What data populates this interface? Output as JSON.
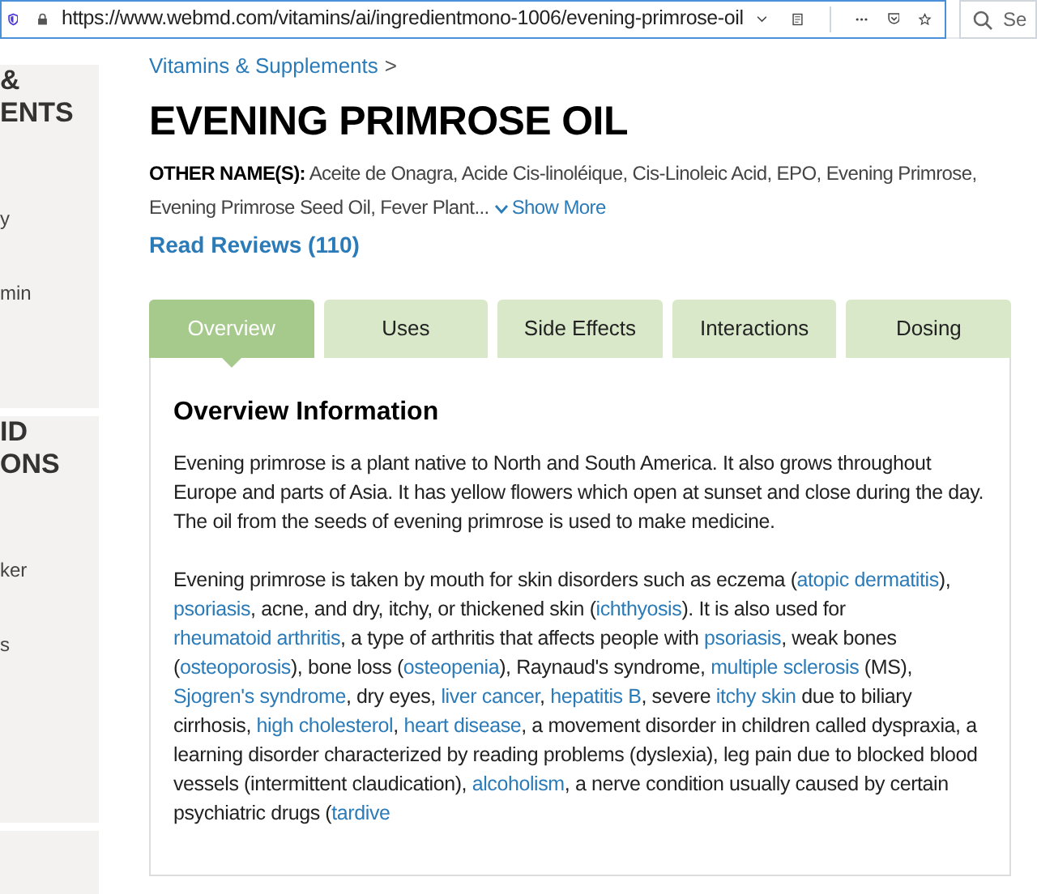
{
  "browser": {
    "url": "https://www.webmd.com/vitamins/ai/ingredientmono-1006/evening-primrose-oil",
    "search_placeholder": "Se"
  },
  "sidebar": {
    "panels": [
      {
        "lines": [
          "&",
          "ENTS"
        ],
        "items": [
          "y",
          "min"
        ]
      },
      {
        "lines": [
          "ID",
          "ONS"
        ],
        "items": [
          "ker",
          "s"
        ]
      }
    ]
  },
  "breadcrumb": {
    "label": "Vitamins & Supplements",
    "separator": ">"
  },
  "title": "EVENING PRIMROSE OIL",
  "other_names": {
    "label": "OTHER NAME(S):",
    "text": "Aceite de Onagra, Acide Cis-linoléique, Cis-Linoleic Acid, EPO, Evening Primrose, Evening Primrose Seed Oil, Fever Plant...",
    "toggle": "Show More"
  },
  "reviews_link": "Read Reviews (110)",
  "tabs": [
    {
      "label": "Overview",
      "selected": true
    },
    {
      "label": "Uses",
      "selected": false
    },
    {
      "label": "Side Effects",
      "selected": false
    },
    {
      "label": "Interactions",
      "selected": false
    },
    {
      "label": "Dosing",
      "selected": false
    }
  ],
  "section": {
    "heading": "Overview Information",
    "paragraphs": [
      [
        {
          "kind": "text",
          "text": "Evening primrose is a plant native to North and South America. It also grows throughout Europe and parts of Asia. It has yellow flowers which open at sunset and close during the day. The oil from the seeds of evening primrose is used to make medicine."
        }
      ],
      [
        {
          "kind": "text",
          "text": "Evening primrose is taken by mouth for skin disorders such as eczema ("
        },
        {
          "kind": "link",
          "text": "atopic dermatitis"
        },
        {
          "kind": "text",
          "text": "), "
        },
        {
          "kind": "link",
          "text": "psoriasis"
        },
        {
          "kind": "text",
          "text": ", acne, and dry, itchy, or thickened skin ("
        },
        {
          "kind": "link",
          "text": "ichthyosis"
        },
        {
          "kind": "text",
          "text": "). It is also used for "
        },
        {
          "kind": "link",
          "text": "rheumatoid arthritis"
        },
        {
          "kind": "text",
          "text": ", a type of arthritis that affects people with "
        },
        {
          "kind": "link",
          "text": "psoriasis"
        },
        {
          "kind": "text",
          "text": ", weak bones ("
        },
        {
          "kind": "link",
          "text": "osteoporosis"
        },
        {
          "kind": "text",
          "text": "), bone loss ("
        },
        {
          "kind": "link",
          "text": "osteopenia"
        },
        {
          "kind": "text",
          "text": "), Raynaud's syndrome, "
        },
        {
          "kind": "link",
          "text": "multiple sclerosis"
        },
        {
          "kind": "text",
          "text": " (MS), "
        },
        {
          "kind": "link",
          "text": "Sjogren's syndrome"
        },
        {
          "kind": "text",
          "text": ", dry eyes, "
        },
        {
          "kind": "link",
          "text": "liver cancer"
        },
        {
          "kind": "text",
          "text": ", "
        },
        {
          "kind": "link",
          "text": "hepatitis B"
        },
        {
          "kind": "text",
          "text": ", severe "
        },
        {
          "kind": "link",
          "text": "itchy skin"
        },
        {
          "kind": "text",
          "text": " due to biliary cirrhosis, "
        },
        {
          "kind": "link",
          "text": "high cholesterol"
        },
        {
          "kind": "text",
          "text": ", "
        },
        {
          "kind": "link",
          "text": "heart disease"
        },
        {
          "kind": "text",
          "text": ", a movement disorder in children called dyspraxia, a learning disorder characterized by reading problems (dyslexia), leg pain due to blocked blood vessels (intermittent claudication), "
        },
        {
          "kind": "link",
          "text": "alcoholism"
        },
        {
          "kind": "text",
          "text": ", a nerve condition usually caused by certain psychiatric drugs ("
        },
        {
          "kind": "link",
          "text": "tardive"
        }
      ]
    ]
  }
}
